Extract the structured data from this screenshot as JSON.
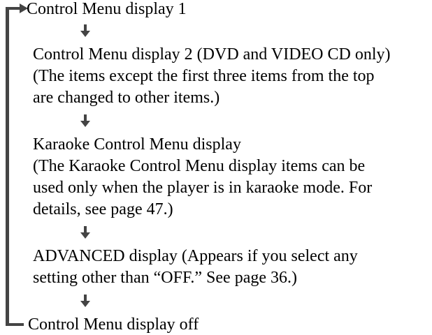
{
  "flow": {
    "step1": "Control Menu display 1",
    "step2": {
      "line1": "Control Menu display 2  (DVD and VIDEO CD only)",
      "line2": "(The items except the first three items from the top",
      "line3": "are changed to other items.)"
    },
    "step3": {
      "line1": "Karaoke Control Menu display",
      "line2": "(The Karaoke Control Menu display items can be",
      "line3": "used only when the player is in karaoke mode. For",
      "line4": "details, see page 47.)"
    },
    "step4": {
      "line1": "ADVANCED display (Appears if you select any",
      "line2": "setting other than “OFF.”  See page 36.)"
    },
    "step5": "Control Menu display off"
  },
  "colors": {
    "text": "#000000",
    "loop_line": "#444444",
    "arrow": "#444444"
  }
}
